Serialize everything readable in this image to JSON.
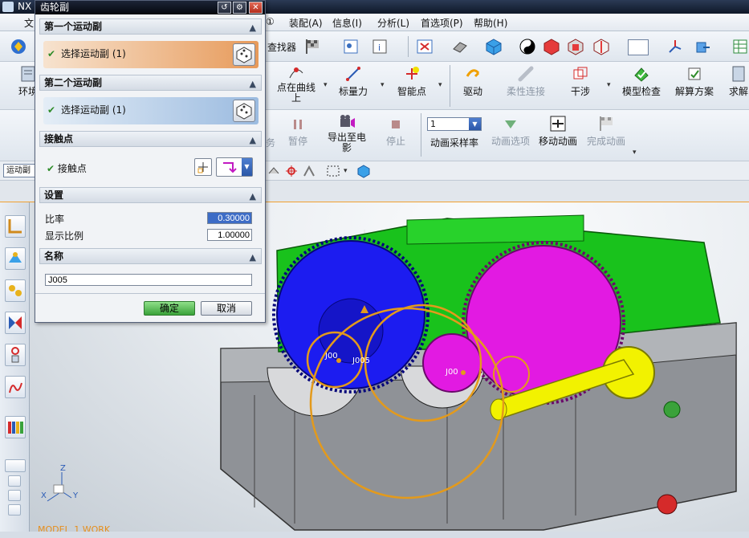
{
  "app": {
    "title": "NX"
  },
  "menubar": {
    "items": [
      "文",
      "①",
      "装配(A)",
      "信息(I)",
      "分析(L)",
      "首选项(P)",
      "帮助(H)"
    ]
  },
  "toolbar1": {
    "finder_label": "查找器"
  },
  "toolbar2": {
    "env_label": "环境",
    "point_on_curve_label": "点在曲线上",
    "scalar_force_label": "标量力",
    "smart_point_label": "智能点",
    "driver_label": "驱动",
    "flexible_link_label": "柔性连接",
    "interference_label": "干涉",
    "model_check_label": "模型检查",
    "solution_label": "解算方案",
    "solve_label": "求解"
  },
  "toolbar3": {
    "items_label": "务",
    "pause_label": "暂停",
    "export_movie_label": "导出至电影",
    "stop_label": "停止",
    "animation_step_value": "1",
    "animation_step_label": "动画采样率",
    "animation_options_label": "动画选项",
    "move_animation_label": "移动动画",
    "finish_animation_label": "完成动画"
  },
  "toolbar4": {
    "context_combo": "运动副"
  },
  "dialog": {
    "title": "齿轮副",
    "section1": {
      "header": "第一个运动副",
      "select_label": "选择运动副 (1)"
    },
    "section2": {
      "header": "第二个运动副",
      "select_label": "选择运动副 (1)"
    },
    "section3": {
      "header": "接触点",
      "contact_label": "接触点"
    },
    "section4": {
      "header": "设置",
      "ratio_label": "比率",
      "ratio_value": "0.30000",
      "display_scale_label": "显示比例",
      "display_scale_value": "1.00000"
    },
    "section5": {
      "header": "名称",
      "name_value": "J005"
    },
    "ok_label": "确定",
    "cancel_label": "取消"
  },
  "viewport": {
    "joint_labels": [
      "J00",
      "J005",
      "J00"
    ],
    "axis_z": "Z",
    "axis_y": "Y",
    "axis_x": "X",
    "status": "MODEL_1 WORK"
  },
  "colors": {
    "gear_blue": "#1c1cf0",
    "gear_magenta": "#e21ae2",
    "housing_green": "#19c21c",
    "shaft_yellow": "#f2f200",
    "housing_gray": "#8f9297",
    "joint_orange": "#e39a1c"
  }
}
